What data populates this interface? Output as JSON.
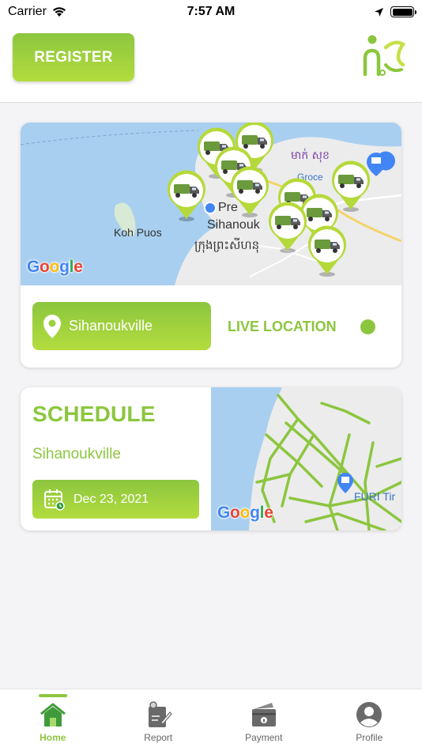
{
  "status_bar": {
    "carrier": "Carrier",
    "time": "7:57 AM"
  },
  "header": {
    "register_label": "REGISTER"
  },
  "live_card": {
    "map_labels": {
      "koh_puos": "Koh Puos",
      "city_line1": "Sihanouk",
      "city_khmer": "ក្រុងព្រះសីហនុ",
      "pin_label": "Pre",
      "top_khmer": "មាក់ សុខ",
      "grocer": "Groce"
    },
    "location_label": "Sihanoukville",
    "live_label": "LIVE LOCATION"
  },
  "schedule_card": {
    "title": "SCHEDULE",
    "city": "Sihanoukville",
    "date": "Dec 23, 2021",
    "map_labels": {
      "poi": "FURI Tir"
    }
  },
  "google_logo": [
    "G",
    "o",
    "o",
    "g",
    "l",
    "e"
  ],
  "tabs": [
    {
      "label": "Home",
      "icon": "home-icon",
      "active": true
    },
    {
      "label": "Report",
      "icon": "report-icon",
      "active": false
    },
    {
      "label": "Payment",
      "icon": "payment-icon",
      "active": false
    },
    {
      "label": "Profile",
      "icon": "profile-icon",
      "active": false
    }
  ],
  "colors": {
    "accent": "#8cc63f",
    "accent_light": "#b3dc3e",
    "map_water": "#a9cff0",
    "map_land": "#ececec"
  }
}
